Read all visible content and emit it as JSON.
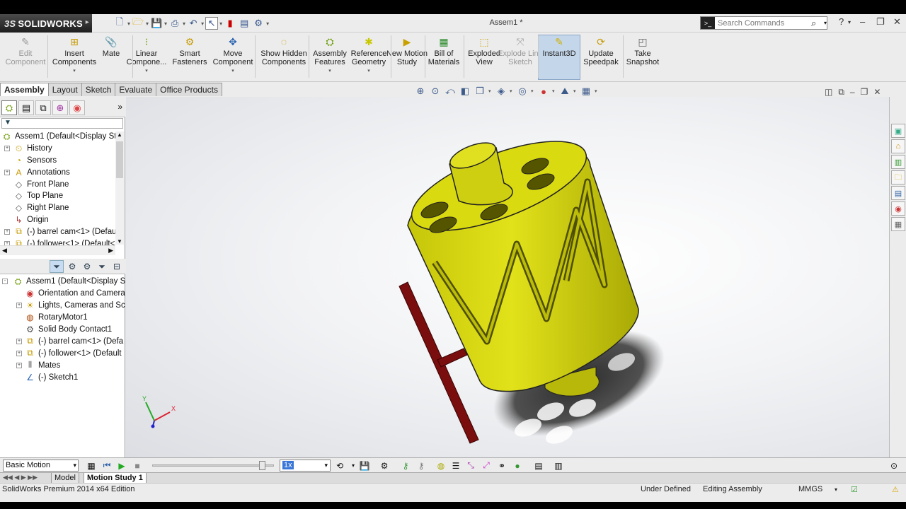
{
  "app": {
    "name": "SOLIDWORKS",
    "document_title": "Assem1 *"
  },
  "search": {
    "placeholder": "Search Commands"
  },
  "commands": [
    {
      "label": "Edit Component",
      "icon": "edit-component-icon",
      "disabled": true
    },
    {
      "label": "Insert Components",
      "icon": "insert-components-icon",
      "dropdown": true
    },
    {
      "label": "Mate",
      "icon": "mate-icon"
    },
    {
      "label": "Linear Compone...",
      "icon": "linear-pattern-icon",
      "dropdown": true
    },
    {
      "label": "Smart Fasteners",
      "icon": "smart-fasteners-icon"
    },
    {
      "label": "Move Component",
      "icon": "move-component-icon",
      "dropdown": true
    },
    {
      "label": "Show Hidden Components",
      "icon": "show-hidden-icon"
    },
    {
      "label": "Assembly Features",
      "icon": "assembly-features-icon",
      "dropdown": true
    },
    {
      "label": "Reference Geometry",
      "icon": "reference-geometry-icon",
      "dropdown": true
    },
    {
      "label": "New Motion Study",
      "icon": "new-motion-study-icon"
    },
    {
      "label": "Bill of Materials",
      "icon": "bill-of-materials-icon"
    },
    {
      "label": "Exploded View",
      "icon": "exploded-view-icon"
    },
    {
      "label": "Explode Line Sketch",
      "icon": "explode-line-sketch-icon",
      "disabled": true
    },
    {
      "label": "Instant3D",
      "icon": "instant3d-icon",
      "active": true
    },
    {
      "label": "Update Speedpak",
      "icon": "update-speedpak-icon"
    },
    {
      "label": "Take Snapshot",
      "icon": "take-snapshot-icon"
    }
  ],
  "tabs": [
    "Assembly",
    "Layout",
    "Sketch",
    "Evaluate",
    "Office Products"
  ],
  "feature_tree": {
    "filter_label": "▼",
    "items": [
      {
        "label": "Assem1  (Default<Display St",
        "icon": "assembly-icon",
        "level": 0,
        "expander": ""
      },
      {
        "label": "History",
        "icon": "history-icon",
        "level": 1,
        "expander": "+"
      },
      {
        "label": "Sensors",
        "icon": "sensors-icon",
        "level": 1,
        "expander": ""
      },
      {
        "label": "Annotations",
        "icon": "annotations-icon",
        "level": 1,
        "expander": "+"
      },
      {
        "label": "Front Plane",
        "icon": "plane-icon",
        "level": 1,
        "expander": ""
      },
      {
        "label": "Top Plane",
        "icon": "plane-icon",
        "level": 1,
        "expander": ""
      },
      {
        "label": "Right Plane",
        "icon": "plane-icon",
        "level": 1,
        "expander": ""
      },
      {
        "label": "Origin",
        "icon": "origin-icon",
        "level": 1,
        "expander": ""
      },
      {
        "label": "(-) barrel cam<1> (Defau",
        "icon": "part-icon",
        "level": 1,
        "expander": "+"
      },
      {
        "label": "(-) follower<1> (Default<",
        "icon": "part-icon",
        "level": 1,
        "expander": "+"
      }
    ]
  },
  "motion_tree": {
    "items": [
      {
        "label": "Assem1  (Default<Display St",
        "icon": "assembly-icon",
        "level": 0,
        "expander": "-"
      },
      {
        "label": "Orientation and Camera",
        "icon": "orientation-icon",
        "level": 1,
        "expander": ""
      },
      {
        "label": "Lights, Cameras and Sce",
        "icon": "lights-icon",
        "level": 1,
        "expander": "+"
      },
      {
        "label": "RotaryMotor1",
        "icon": "rotary-motor-icon",
        "level": 1,
        "expander": ""
      },
      {
        "label": "Solid Body Contact1",
        "icon": "contact-icon",
        "level": 1,
        "expander": ""
      },
      {
        "label": "(-) barrel cam<1> (Defa",
        "icon": "part-icon",
        "level": 1,
        "expander": "+"
      },
      {
        "label": "(-) follower<1> (Default",
        "icon": "part-icon",
        "level": 1,
        "expander": "+"
      },
      {
        "label": "Mates",
        "icon": "mates-icon",
        "level": 1,
        "expander": "+"
      },
      {
        "label": "(-) Sketch1",
        "icon": "sketch-icon",
        "level": 1,
        "expander": ""
      }
    ]
  },
  "triad": {
    "x_label": "X",
    "y_label": "Y"
  },
  "motion_study": {
    "type": "Basic Motion",
    "playback_speed": "1x",
    "slider_position": 0.93
  },
  "bottom_tabs": [
    "Model",
    "Motion Study 1"
  ],
  "status": {
    "edition": "SolidWorks Premium 2014 x64 Edition",
    "definition": "Under Defined",
    "mode": "Editing Assembly",
    "units": "MMGS"
  },
  "colors": {
    "cam": "#d7d70c",
    "cam_dark": "#8c8c08",
    "follower": "#7a0d0d",
    "accent": "#3a76d8"
  }
}
